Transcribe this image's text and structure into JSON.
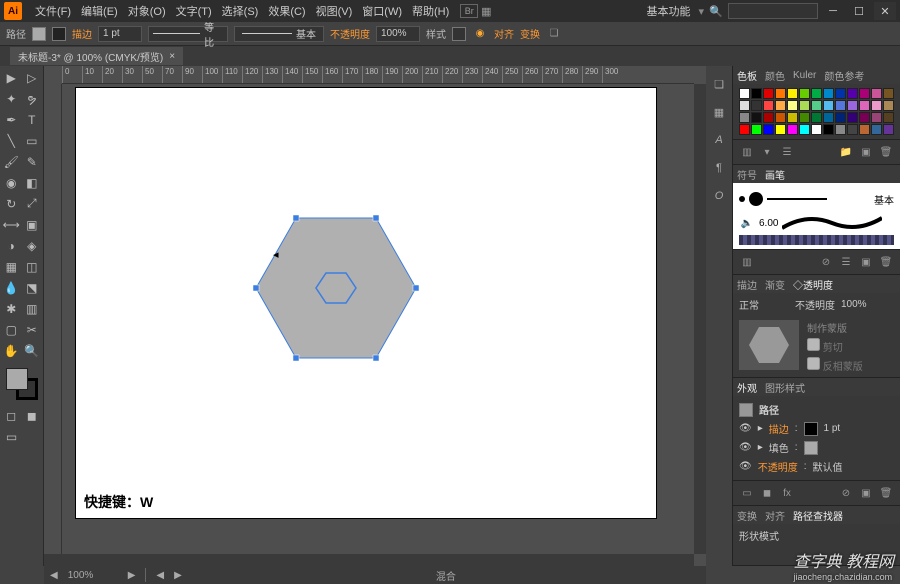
{
  "app": {
    "logo": "Ai"
  },
  "menu": [
    "文件(F)",
    "编辑(E)",
    "对象(O)",
    "文字(T)",
    "选择(S)",
    "效果(C)",
    "视图(V)",
    "窗口(W)",
    "帮助(H)"
  ],
  "workspace_label": "基本功能",
  "search_placeholder": "",
  "options": {
    "mode_label": "路径",
    "stroke_label": "描边",
    "stroke_width": "1 pt",
    "uniform": "等比",
    "basic": "基本",
    "opacity_label": "不透明度",
    "opacity_value": "100%",
    "style_label": "样式",
    "align_label": "对齐",
    "transform_label": "变换"
  },
  "document": {
    "tab_title": "未标题-3* @ 100% (CMYK/预览)"
  },
  "ruler_ticks": [
    "0",
    "10",
    "20",
    "30",
    "50",
    "70",
    "90",
    "100",
    "110",
    "120",
    "130",
    "140",
    "150",
    "160",
    "170",
    "180",
    "190",
    "200",
    "210",
    "220",
    "230",
    "240",
    "250",
    "260",
    "270",
    "280",
    "290",
    "300"
  ],
  "canvas": {
    "shortcut": "快捷键：W"
  },
  "status": {
    "zoom": "100%",
    "blend_label": "混合"
  },
  "panels": {
    "color": {
      "tabs": [
        "色板",
        "颜色",
        "Kuler",
        "颜色参考"
      ]
    },
    "brushes": {
      "tabs": [
        "符号",
        "画笔"
      ],
      "stroke_size": "6.00",
      "basic_label": "基本"
    },
    "transparency": {
      "tabs": [
        "描边",
        "渐变",
        "◇透明度"
      ],
      "mode": "正常",
      "opacity_label": "不透明度",
      "opacity_value": "100%",
      "make_mask": "制作蒙版",
      "clip": "剪切",
      "invert": "反相蒙版"
    },
    "appearance": {
      "tabs": [
        "外观",
        "图形样式"
      ],
      "path_label": "路径",
      "stroke_label": "描边",
      "stroke_value": "1 pt",
      "fill_label": "填色",
      "opacity_label": "不透明度",
      "opacity_value": "默认值"
    },
    "pathfinder": {
      "tabs": [
        "变换",
        "对齐",
        "路径查找器"
      ],
      "shape_modes": "形状模式"
    }
  },
  "colors": {
    "swatches_row1": [
      "#ffffff",
      "#000000",
      "#e00000",
      "#ff7700",
      "#ffee00",
      "#66cc00",
      "#00aa44",
      "#0088cc",
      "#0033aa",
      "#5500aa",
      "#aa0077",
      "#cc5599",
      "#775522"
    ],
    "swatches_row2": [
      "#dedede",
      "#333333",
      "#ff4444",
      "#ffaa44",
      "#ffff88",
      "#aadd55",
      "#55cc88",
      "#55bbee",
      "#5577dd",
      "#9966dd",
      "#dd66bb",
      "#ee99cc",
      "#aa8855"
    ],
    "swatches_row3": [
      "#888888",
      "#111111",
      "#aa0000",
      "#cc5500",
      "#ccbb00",
      "#448800",
      "#007733",
      "#006699",
      "#002277",
      "#330077",
      "#770055",
      "#994477",
      "#554022"
    ],
    "swatches_row4": [
      "#ff0000",
      "#00ff00",
      "#0000ff",
      "#ffff00",
      "#ff00ff",
      "#00ffff",
      "#ffffff",
      "#000000",
      "#888888",
      "#444444",
      "#bb6633",
      "#336699",
      "#663399"
    ]
  },
  "watermark": {
    "main": "查字典 教程网",
    "sub": "jiaocheng.chazidian.com"
  }
}
